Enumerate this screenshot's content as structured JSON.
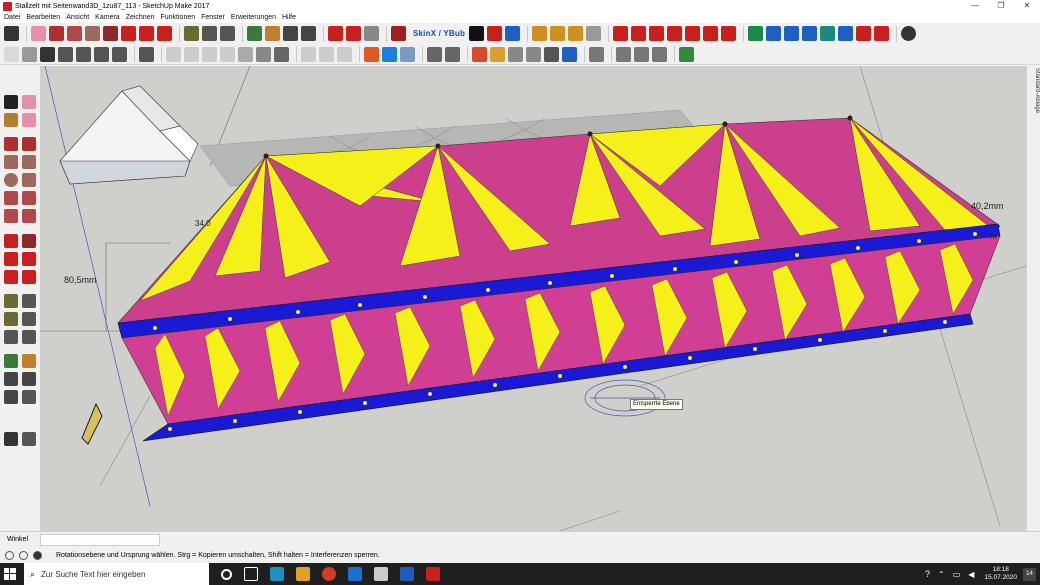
{
  "window": {
    "title": "Stallzelt mit Seitenwand3D_1zu87_113 - SketchUp Make 2017",
    "min": "—",
    "max": "❐",
    "close": "✕"
  },
  "menu": [
    "Datei",
    "Bearbeiten",
    "Ansicht",
    "Kamera",
    "Zeichnen",
    "Funktionen",
    "Fenster",
    "Erweiterungen",
    "Hilfe"
  ],
  "toolbar": {
    "skin_label": "SkinX / YBub",
    "colors": {
      "red": "#c8201e",
      "blue": "#1f5fbf",
      "green": "#2e8b3d",
      "yellow": "#e6b800",
      "gray": "#777777"
    }
  },
  "viewport": {
    "dim_left": "80,5mm",
    "dim_top": "34,0",
    "dim_right": "40,2mm",
    "dim_right2": "m",
    "tooltip": "Entsperrte Ebene"
  },
  "tray": {
    "label": "Standard-Ablage"
  },
  "measure": {
    "label": "Winkel"
  },
  "status": {
    "hint": "Rotationsebene und Ursprung wählen. Strg = Kopieren umschalten, Shift halten = Interferenzen sperren."
  },
  "taskbar": {
    "search_placeholder": "Zur Suche Text hier eingeben",
    "time": "18:18",
    "date": "15.07.2020",
    "notif_count": "14"
  }
}
